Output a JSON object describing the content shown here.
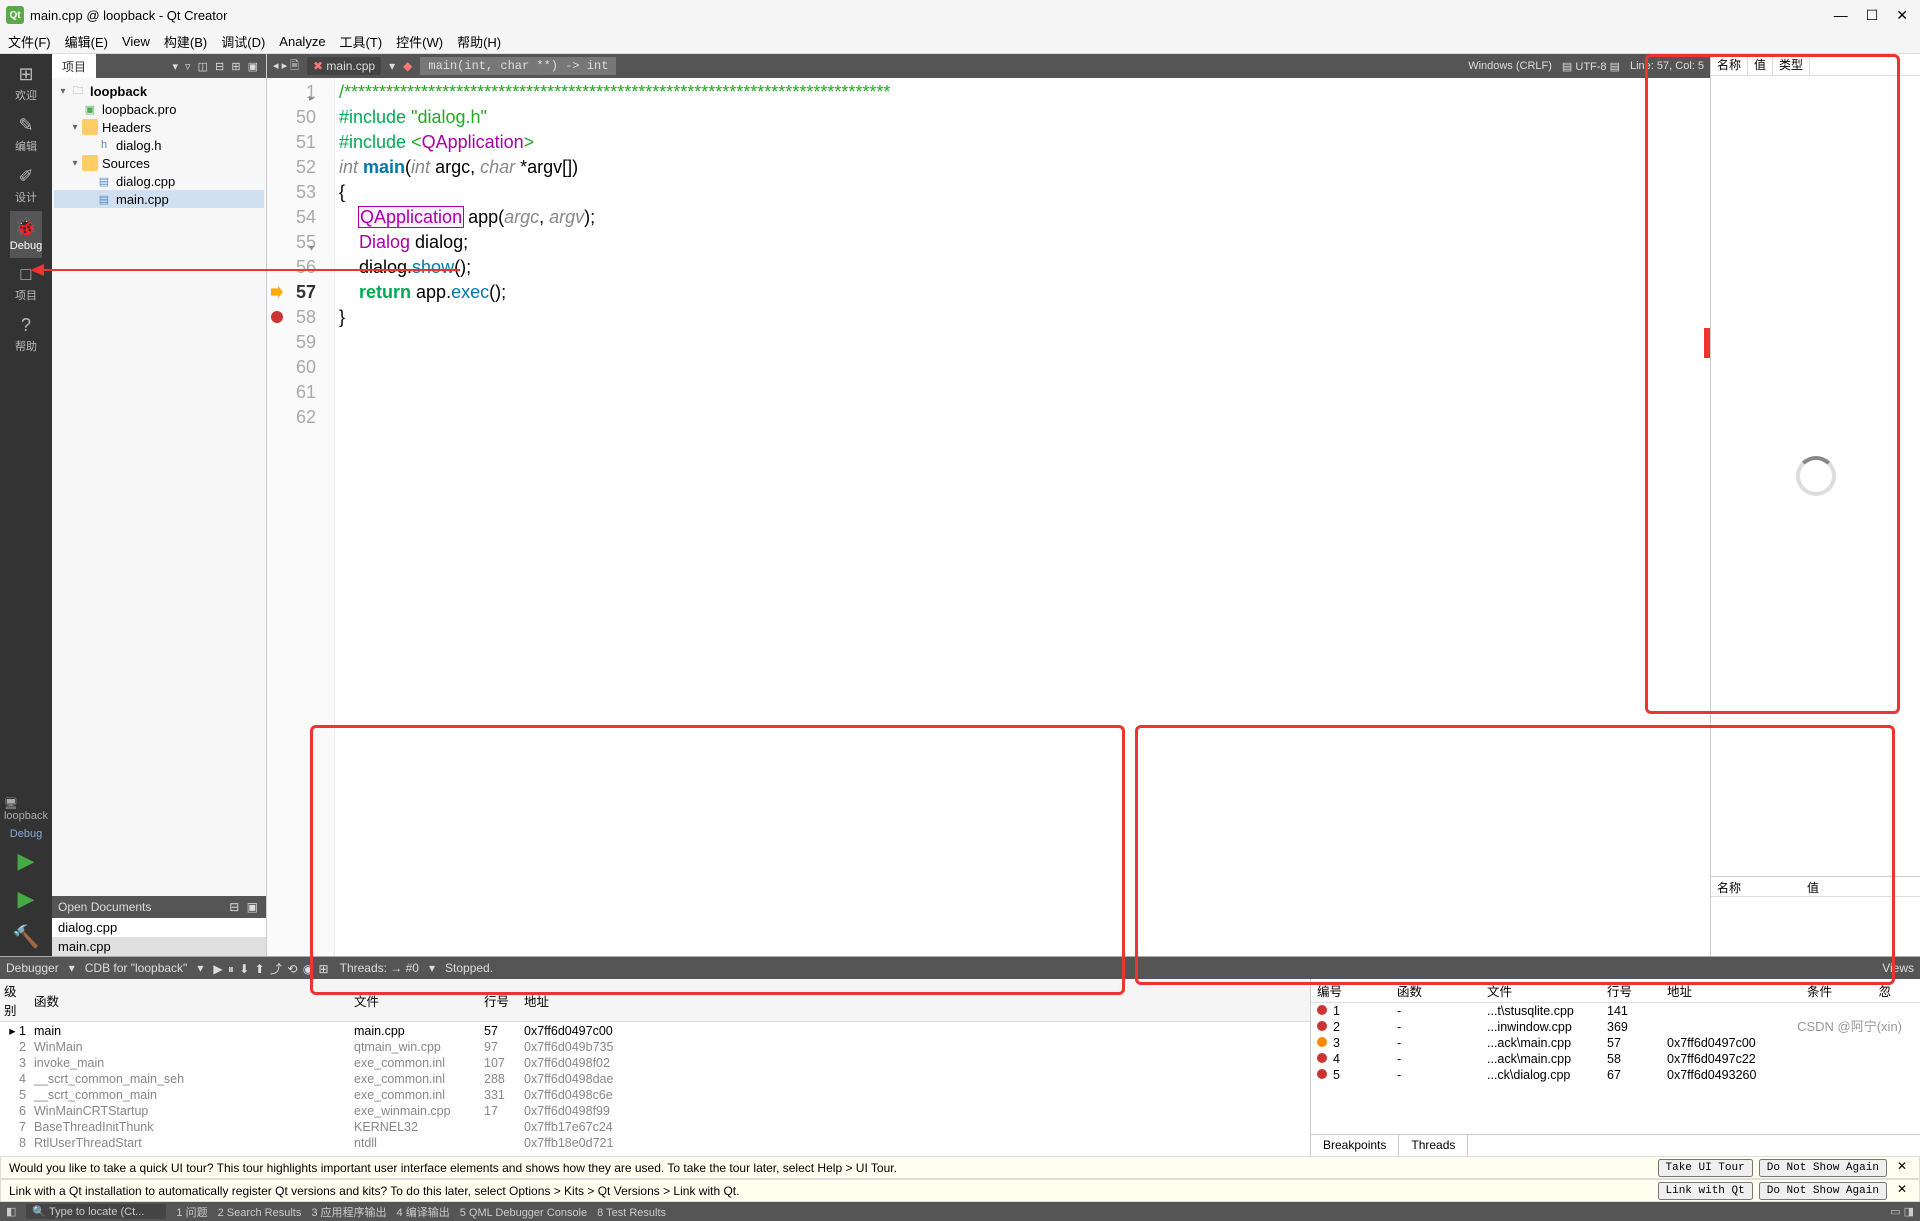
{
  "title": "main.cpp @ loopback - Qt Creator",
  "menu": [
    "文件(F)",
    "编辑(E)",
    "View",
    "构建(B)",
    "调试(D)",
    "Analyze",
    "工具(T)",
    "控件(W)",
    "帮助(H)"
  ],
  "leftbar": {
    "items": [
      {
        "icon": "⊞",
        "label": "欢迎"
      },
      {
        "icon": "✎",
        "label": "编辑"
      },
      {
        "icon": "✐",
        "label": "设计"
      },
      {
        "icon": "🐞",
        "label": "Debug"
      },
      {
        "icon": "□",
        "label": "项目"
      },
      {
        "icon": "?",
        "label": "帮助"
      }
    ],
    "kit": "loopback",
    "mode": "Debug"
  },
  "project": {
    "tab": "项目",
    "tools": "▾ ▿ ◫ ⊟ ⊞ ▣",
    "root": "loopback",
    "pro": "loopback.pro",
    "headers_label": "Headers",
    "headers": [
      "dialog.h"
    ],
    "sources_label": "Sources",
    "sources": [
      "dialog.cpp",
      "main.cpp"
    ]
  },
  "opendocs": {
    "title": "Open Documents",
    "items": [
      "dialog.cpp",
      "main.cpp"
    ]
  },
  "editor": {
    "nav": "◂ ▸ 🗎",
    "file": "main.cpp",
    "func": "main(int, char **) -> int",
    "encoding": "Windows (CRLF)",
    "charset": "UTF-8",
    "pos": "Line: 57, Col: 5",
    "lines": [
      {
        "n": 1,
        "fold": "▸",
        "cmt": "/******************************************************************************"
      },
      {
        "n": 50,
        "txt": ""
      },
      {
        "n": 51,
        "inc": "#include",
        "str": "\"dialog.h\""
      },
      {
        "n": 52,
        "txt": ""
      },
      {
        "n": 53,
        "inc": "#include",
        "ang": "<QApplication>"
      },
      {
        "n": 54,
        "txt": ""
      },
      {
        "n": 55,
        "fold": "▾",
        "line55": true
      },
      {
        "n": 56,
        "txt": "{"
      },
      {
        "n": 57,
        "cur": true,
        "bp": "arrow",
        "line57": true
      },
      {
        "n": 58,
        "bp": "dot",
        "line58": true
      },
      {
        "n": 59,
        "line59": true
      },
      {
        "n": 60,
        "line60": true
      },
      {
        "n": 61,
        "txt": "}"
      },
      {
        "n": 62,
        "txt": ""
      }
    ]
  },
  "locals": {
    "c1": "名称",
    "c2": "值",
    "c3": "类型",
    "lower_c1": "名称",
    "lower_c2": "值"
  },
  "debugger": {
    "label": "Debugger",
    "kit": "CDB for \"loopback\"",
    "threads": "Threads: → #0",
    "state": "Stopped.",
    "btns": "▶ ⏸ ⬇ ⬆ ⤴ ⟲ ◉ ⊞"
  },
  "stack": {
    "cols": [
      "级别",
      "函数",
      "文件",
      "行号",
      "地址"
    ],
    "rows": [
      {
        "lv": "1",
        "fn": "main",
        "file": "main.cpp",
        "ln": "57",
        "addr": "0x7ff6d0497c00",
        "cur": true
      },
      {
        "lv": "2",
        "fn": "WinMain",
        "file": "qtmain_win.cpp",
        "ln": "97",
        "addr": "0x7ff6d049b735"
      },
      {
        "lv": "3",
        "fn": "invoke_main",
        "file": "exe_common.inl",
        "ln": "107",
        "addr": "0x7ff6d0498f02"
      },
      {
        "lv": "4",
        "fn": "__scrt_common_main_seh",
        "file": "exe_common.inl",
        "ln": "288",
        "addr": "0x7ff6d0498dae"
      },
      {
        "lv": "5",
        "fn": "__scrt_common_main",
        "file": "exe_common.inl",
        "ln": "331",
        "addr": "0x7ff6d0498c6e"
      },
      {
        "lv": "6",
        "fn": "WinMainCRTStartup",
        "file": "exe_winmain.cpp",
        "ln": "17",
        "addr": "0x7ff6d0498f99"
      },
      {
        "lv": "7",
        "fn": "BaseThreadInitThunk",
        "file": "KERNEL32",
        "ln": "",
        "addr": "0x7ffb17e67c24"
      },
      {
        "lv": "8",
        "fn": "RtlUserThreadStart",
        "file": "ntdll",
        "ln": "",
        "addr": "0x7ffb18e0d721"
      }
    ]
  },
  "breakpoints": {
    "cols": [
      "编号",
      "函数",
      "文件",
      "行号",
      "地址",
      "条件",
      "忽"
    ],
    "rows": [
      {
        "n": "1",
        "dot": "r",
        "fn": "-",
        "file": "...t\\stusqlite.cpp",
        "ln": "141",
        "addr": ""
      },
      {
        "n": "2",
        "dot": "r",
        "fn": "-",
        "file": "...inwindow.cpp",
        "ln": "369",
        "addr": ""
      },
      {
        "n": "3",
        "dot": "o",
        "fn": "-",
        "file": "...ack\\main.cpp",
        "ln": "57",
        "addr": "0x7ff6d0497c00"
      },
      {
        "n": "4",
        "dot": "r",
        "fn": "-",
        "file": "...ack\\main.cpp",
        "ln": "58",
        "addr": "0x7ff6d0497c22"
      },
      {
        "n": "5",
        "dot": "r",
        "fn": "-",
        "file": "...ck\\dialog.cpp",
        "ln": "67",
        "addr": "0x7ff6d0493260"
      }
    ],
    "tabs": [
      "Breakpoints",
      "Threads"
    ],
    "views": "Views"
  },
  "info1": {
    "msg": "Would you like to take a quick UI tour? This tour highlights important user interface elements and shows how they are used. To take the tour later, select Help > UI Tour.",
    "b1": "Take UI Tour",
    "b2": "Do Not Show Again"
  },
  "info2": {
    "msg": "Link with a Qt installation to automatically register Qt versions and kits? To do this later, select Options > Kits > Qt Versions > Link with Qt.",
    "b1": "Link with Qt",
    "b2": "Do Not Show Again"
  },
  "bottom": {
    "search": "Type to locate (Ct...",
    "items": [
      "1 问题",
      "2 Search Results",
      "3 应用程序输出",
      "4 编译输出",
      "5 QML Debugger Console",
      "8 Test Results"
    ]
  },
  "watermark": "CSDN @阿宁(xin)"
}
